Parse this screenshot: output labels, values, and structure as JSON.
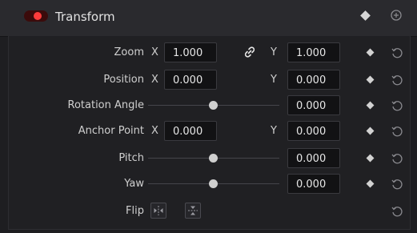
{
  "header": {
    "title": "Transform",
    "enabled": true,
    "toggle_color": "#ff3b3b",
    "keyframe_icon": "diamond-icon",
    "reset_icon": "reset-all-icon"
  },
  "rows": {
    "zoom": {
      "label": "Zoom",
      "x_axis": "X",
      "x_value": "1.000",
      "y_axis": "Y",
      "y_value": "1.000",
      "link_icon": "link-icon"
    },
    "position": {
      "label": "Position",
      "x_axis": "X",
      "x_value": "0.000",
      "y_axis": "Y",
      "y_value": "0.000"
    },
    "rotation": {
      "label": "Rotation Angle",
      "value": "0.000",
      "slider_level": 0.5
    },
    "anchor": {
      "label": "Anchor Point",
      "x_axis": "X",
      "x_value": "0.000",
      "y_axis": "Y",
      "y_value": "0.000"
    },
    "pitch": {
      "label": "Pitch",
      "value": "0.000",
      "slider_level": 0.5
    },
    "yaw": {
      "label": "Yaw",
      "value": "0.000",
      "slider_level": 0.5
    },
    "flip": {
      "label": "Flip",
      "horizontal_icon": "flip-horizontal-icon",
      "vertical_icon": "flip-vertical-icon"
    }
  }
}
